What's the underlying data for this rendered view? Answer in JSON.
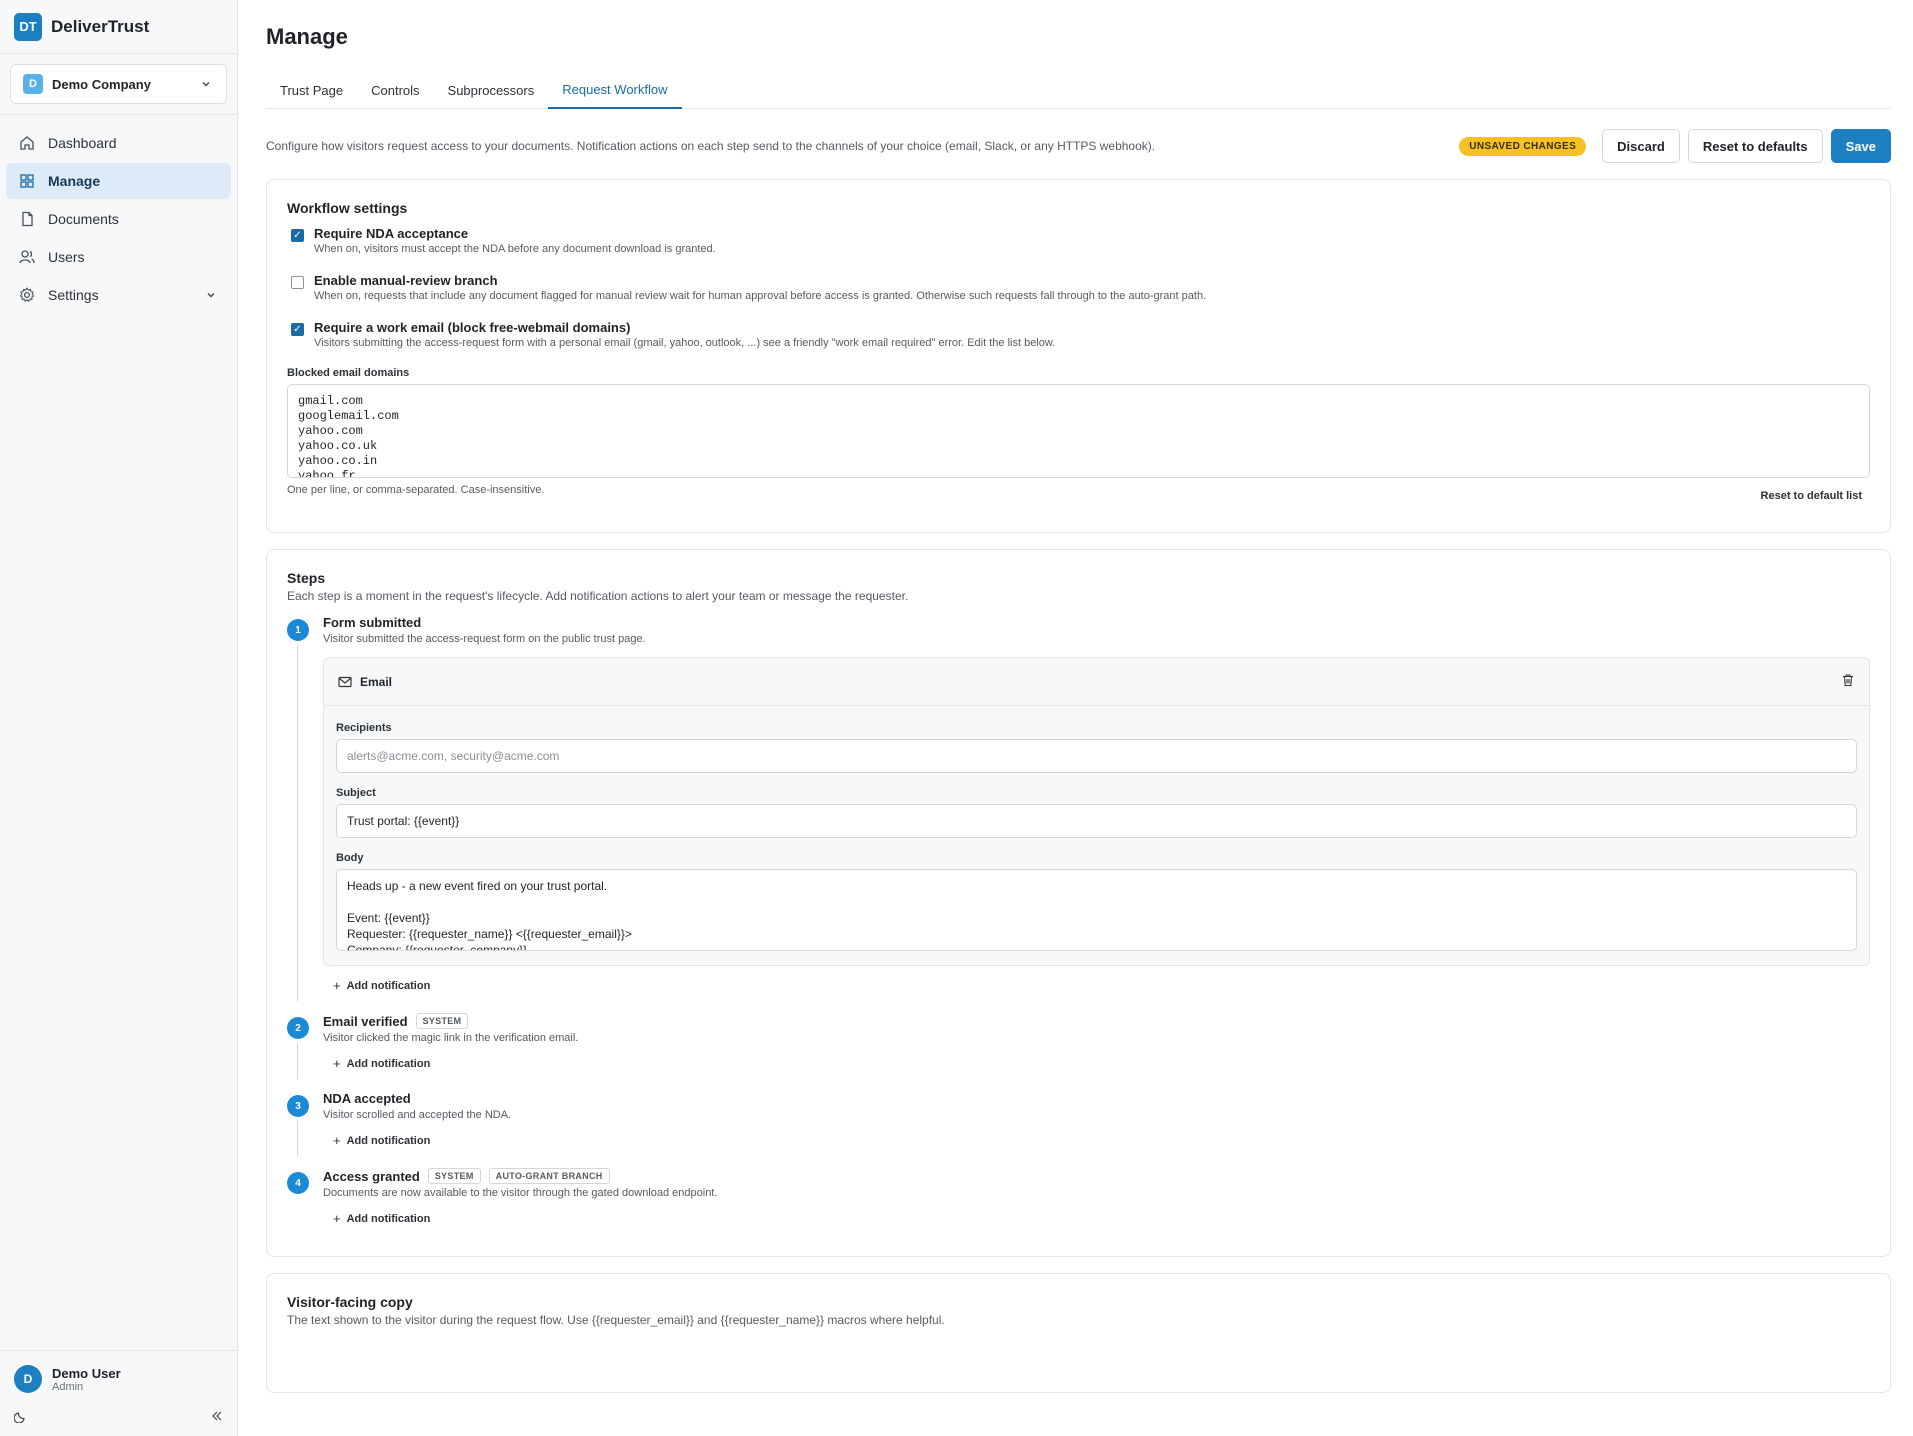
{
  "app": {
    "logo_text": "DT",
    "name": "DeliverTrust"
  },
  "company": {
    "badge": "D",
    "name": "Demo Company"
  },
  "nav": [
    {
      "label": "Dashboard",
      "icon": "home-icon",
      "active": false
    },
    {
      "label": "Manage",
      "icon": "grid-icon",
      "active": true
    },
    {
      "label": "Documents",
      "icon": "document-icon",
      "active": false
    },
    {
      "label": "Users",
      "icon": "users-icon",
      "active": false
    },
    {
      "label": "Settings",
      "icon": "gear-icon",
      "active": false
    }
  ],
  "user": {
    "initial": "D",
    "name": "Demo User",
    "role": "Admin"
  },
  "page": {
    "title": "Manage",
    "tabs": [
      "Trust Page",
      "Controls",
      "Subprocessors",
      "Request Workflow"
    ],
    "active_tab": "Request Workflow",
    "intro": "Configure how visitors request access to your documents. Notification actions on each step send to the channels of your choice (email, Slack, or any HTTPS webhook).",
    "unsaved_badge": "UNSAVED CHANGES",
    "discard_label": "Discard",
    "reset_label": "Reset to defaults",
    "save_label": "Save"
  },
  "workflow": {
    "title": "Workflow settings",
    "options": [
      {
        "label": "Require NDA acceptance",
        "desc": "When on, visitors must accept the NDA before any document download is granted.",
        "checked": true
      },
      {
        "label": "Enable manual-review branch",
        "desc": "When on, requests that include any document flagged for manual review wait for human approval before access is granted. Otherwise such requests fall through to the auto-grant path.",
        "checked": false
      },
      {
        "label": "Require a work email (block free-webmail domains)",
        "desc": "Visitors submitting the access-request form with a personal email (gmail, yahoo, outlook, ...) see a friendly \"work email required\" error. Edit the list below.",
        "checked": true
      }
    ],
    "blocked_label": "Blocked email domains",
    "blocked_domains": "gmail.com\ngooglemail.com\nyahoo.com\nyahoo.co.uk\nyahoo.co.in\nyahoo.fr",
    "blocked_hint": "One per line, or comma-separated. Case-insensitive.",
    "reset_list_label": "Reset to default list"
  },
  "steps": {
    "title": "Steps",
    "subtitle": "Each step is a moment in the request's lifecycle. Add notification actions to alert your team or message the requester.",
    "add_label": "Add notification",
    "items": [
      {
        "num": "1",
        "title": "Form submitted",
        "tags": [],
        "desc": "Visitor submitted the access-request form on the public trust page."
      },
      {
        "num": "2",
        "title": "Email verified",
        "tags": [
          "SYSTEM"
        ],
        "desc": "Visitor clicked the magic link in the verification email."
      },
      {
        "num": "3",
        "title": "NDA accepted",
        "tags": [],
        "desc": "Visitor scrolled and accepted the NDA."
      },
      {
        "num": "4",
        "title": "Access granted",
        "tags": [
          "SYSTEM",
          "AUTO-GRANT BRANCH"
        ],
        "desc": "Documents are now available to the visitor through the gated download endpoint."
      }
    ],
    "email_action": {
      "title": "Email",
      "recipients_label": "Recipients",
      "recipients_placeholder": "alerts@acme.com, security@acme.com",
      "subject_label": "Subject",
      "subject_value": "Trust portal: {{event}}",
      "body_label": "Body",
      "body_value": "Heads up - a new event fired on your trust portal.\n\nEvent: {{event}}\nRequester: {{requester_name}} <{{requester_email}}>\nCompany: {{requester_company}}"
    }
  },
  "visitor_copy": {
    "title": "Visitor-facing copy",
    "subtitle": "The text shown to the visitor during the request flow. Use {{requester_email}} and {{requester_name}} macros where helpful."
  },
  "colors": {
    "accent": "#1b7fc1",
    "badge": "#f7c024"
  }
}
